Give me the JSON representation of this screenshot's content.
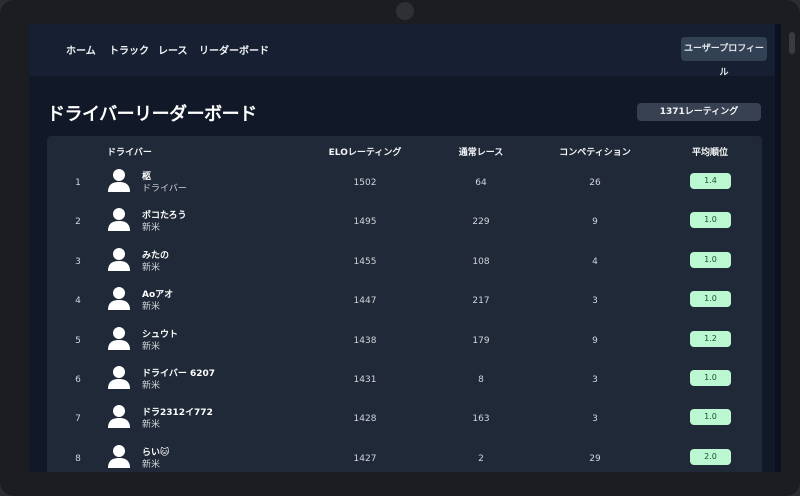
{
  "nav": {
    "links": [
      "ホーム",
      "トラック",
      "レース",
      "リーダーボード"
    ],
    "profile_button": "ユーザープロフィール"
  },
  "page": {
    "title": "ドライバーリーダーボード",
    "rating_badge": "1371レーティング"
  },
  "table": {
    "headers": {
      "driver": "ドライバー",
      "elo": "ELOレーティング",
      "races": "通常レース",
      "competitions": "コンペティション",
      "avg_position": "平均順位"
    },
    "rows": [
      {
        "rank": "1",
        "name": "柩",
        "subtitle": "ドライバー",
        "elo": "1502",
        "races": "64",
        "competitions": "26",
        "avg": "1.4"
      },
      {
        "rank": "2",
        "name": "ポコたろう",
        "subtitle": "新米",
        "elo": "1495",
        "races": "229",
        "competitions": "9",
        "avg": "1.0"
      },
      {
        "rank": "3",
        "name": "みたの",
        "subtitle": "新米",
        "elo": "1455",
        "races": "108",
        "competitions": "4",
        "avg": "1.0"
      },
      {
        "rank": "4",
        "name": "Aoアオ",
        "subtitle": "新米",
        "elo": "1447",
        "races": "217",
        "competitions": "3",
        "avg": "1.0"
      },
      {
        "rank": "5",
        "name": "シュウト",
        "subtitle": "新米",
        "elo": "1438",
        "races": "179",
        "competitions": "9",
        "avg": "1.2"
      },
      {
        "rank": "6",
        "name": "ドライバー 6207",
        "subtitle": "新米",
        "elo": "1431",
        "races": "8",
        "competitions": "3",
        "avg": "1.0"
      },
      {
        "rank": "7",
        "name": "ドラ2312イ772",
        "subtitle": "新米",
        "elo": "1428",
        "races": "163",
        "competitions": "3",
        "avg": "1.0"
      },
      {
        "rank": "8",
        "name": "らい🐱",
        "subtitle": "新米",
        "elo": "1427",
        "races": "2",
        "competitions": "29",
        "avg": "2.0"
      }
    ]
  },
  "colors": {
    "screen_background": "#111827",
    "topbar": "#172033",
    "card": "#1f2937",
    "badge_green": "#bbf7d0",
    "badge_text": "#14532d"
  },
  "icons": {
    "avatar": "user-silhouette-icon"
  }
}
